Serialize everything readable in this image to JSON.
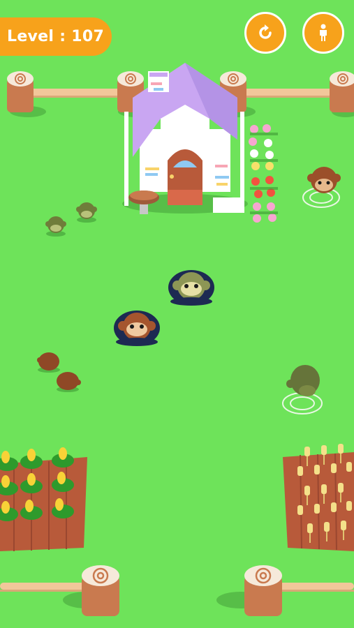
{
  "hud": {
    "level_text": "Level : 107",
    "restart_icon": "restart-icon",
    "character_icon": "person-icon"
  },
  "colors": {
    "grass": "#6ee35a",
    "accent": "#f7a21b",
    "hole_rim": "#1d2a52",
    "fence": "#f2c79a",
    "stump_bark": "#c97a4f",
    "roof": "#c9a6f2",
    "farm_soil": "#b85a3a"
  },
  "scene": {
    "targets": [
      "monkey-hole-olive",
      "monkey-hole-brown"
    ],
    "monkeys": [
      "brown-monkey-ripple",
      "olive-monkey-small-a",
      "olive-monkey-small-b",
      "brown-monkey-small-a",
      "brown-monkey-small-b",
      "olive-monkey-ripple"
    ]
  }
}
